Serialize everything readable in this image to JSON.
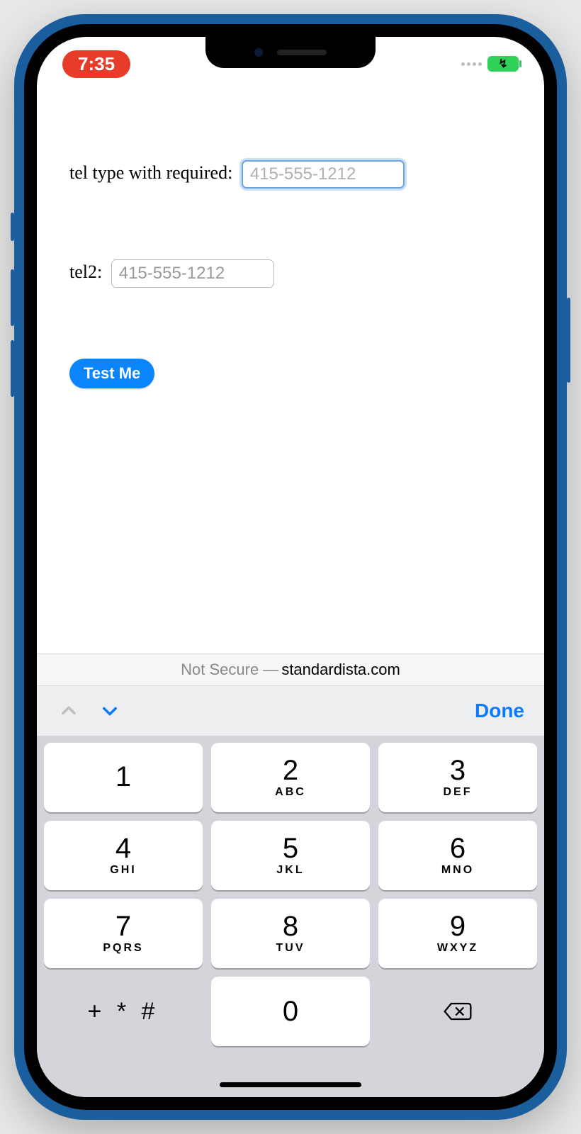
{
  "status": {
    "time": "7:35"
  },
  "form": {
    "field1": {
      "label": "tel type with required: ",
      "placeholder": "415-555-1212"
    },
    "field2": {
      "label": "tel2: ",
      "placeholder": "415-555-1212"
    },
    "button": "Test Me"
  },
  "url": {
    "prefix": "Not Secure — ",
    "domain": "standardista.com"
  },
  "accessory": {
    "done": "Done"
  },
  "keys": {
    "k1": {
      "d": "1",
      "l": ""
    },
    "k2": {
      "d": "2",
      "l": "ABC"
    },
    "k3": {
      "d": "3",
      "l": "DEF"
    },
    "k4": {
      "d": "4",
      "l": "GHI"
    },
    "k5": {
      "d": "5",
      "l": "JKL"
    },
    "k6": {
      "d": "6",
      "l": "MNO"
    },
    "k7": {
      "d": "7",
      "l": "PQRS"
    },
    "k8": {
      "d": "8",
      "l": "TUV"
    },
    "k9": {
      "d": "9",
      "l": "WXYZ"
    },
    "sym": {
      "d": "+ * #"
    },
    "k0": {
      "d": "0"
    }
  }
}
